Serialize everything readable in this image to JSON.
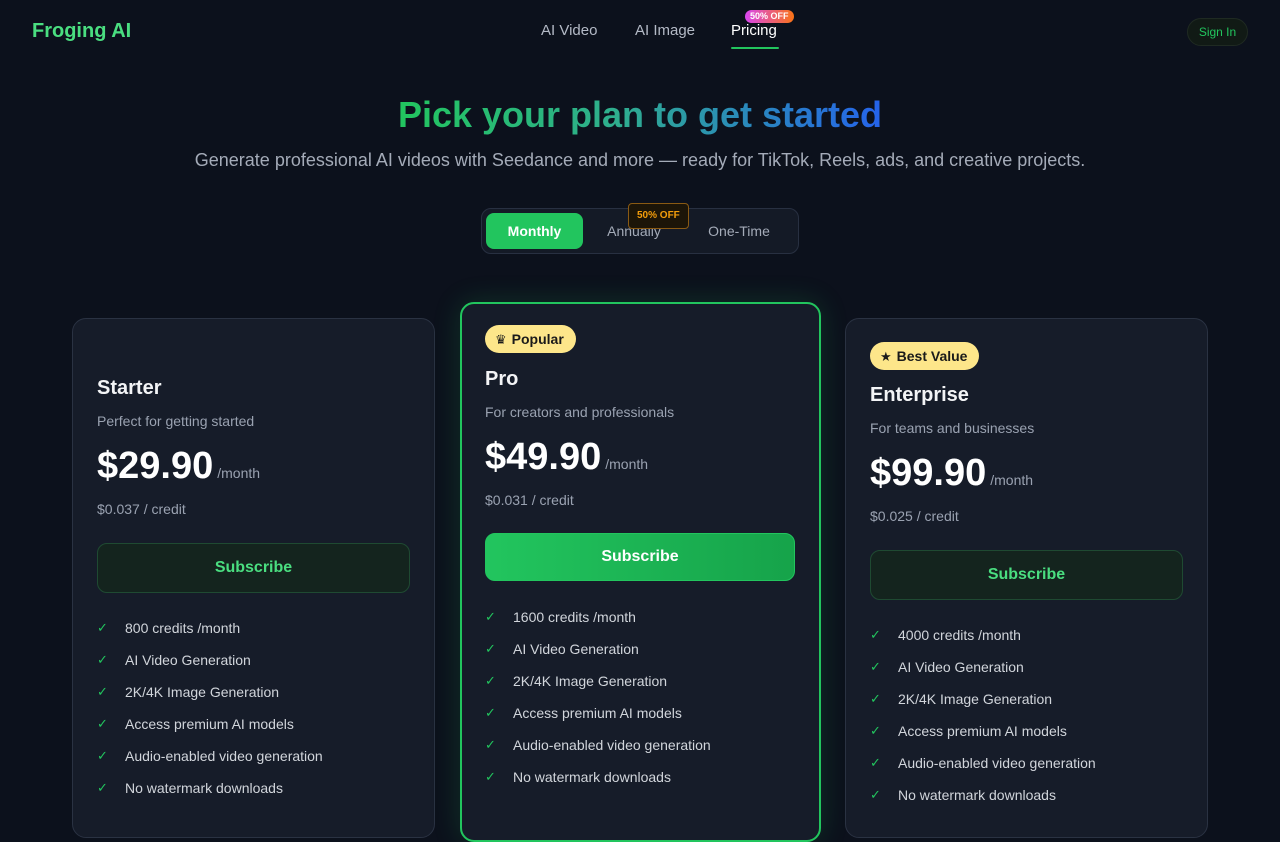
{
  "brand": {
    "name": "Froging AI"
  },
  "nav": {
    "items": [
      "AI Video",
      "AI Image",
      "Pricing"
    ],
    "active": "Pricing",
    "pricing_badge": "50% OFF"
  },
  "header": {
    "signin_label": "Sign In"
  },
  "hero": {
    "title": "Pick your plan to get started",
    "subtitle": "Generate professional AI videos with Seedance and more — ready for TikTok, Reels, ads, and creative projects."
  },
  "billing_toggle": {
    "options": [
      "Monthly",
      "Annually",
      "One-Time"
    ],
    "selected": "Monthly",
    "annual_badge": "50% OFF"
  },
  "plans": [
    {
      "name": "Starter",
      "description": "Perfect for getting started",
      "price": "$29.90",
      "period": "/month",
      "per_credit": "$0.037 / credit",
      "button": "Subscribe",
      "features": [
        "800 credits /month",
        "AI Video Generation",
        "2K/4K Image Generation",
        "Access premium AI models",
        "Audio-enabled video generation",
        "No watermark downloads"
      ]
    },
    {
      "badge": "Popular",
      "badge_icon": "crown-icon",
      "name": "Pro",
      "description": "For creators and professionals",
      "price": "$49.90",
      "period": "/month",
      "per_credit": "$0.031 / credit",
      "button": "Subscribe",
      "features": [
        "1600 credits /month",
        "AI Video Generation",
        "2K/4K Image Generation",
        "Access premium AI models",
        "Audio-enabled video generation",
        "No watermark downloads"
      ]
    },
    {
      "badge": "Best Value",
      "badge_icon": "star-icon",
      "name": "Enterprise",
      "description": "For teams and businesses",
      "price": "$99.90",
      "period": "/month",
      "per_credit": "$0.025 / credit",
      "button": "Subscribe",
      "features": [
        "4000 credits /month",
        "AI Video Generation",
        "2K/4K Image Generation",
        "Access premium AI models",
        "Audio-enabled video generation",
        "No watermark downloads"
      ]
    }
  ],
  "colors": {
    "background": "#0c111c",
    "accent": "#22c55e",
    "badge": "#fde68a",
    "gradient_end": "#2563eb"
  }
}
